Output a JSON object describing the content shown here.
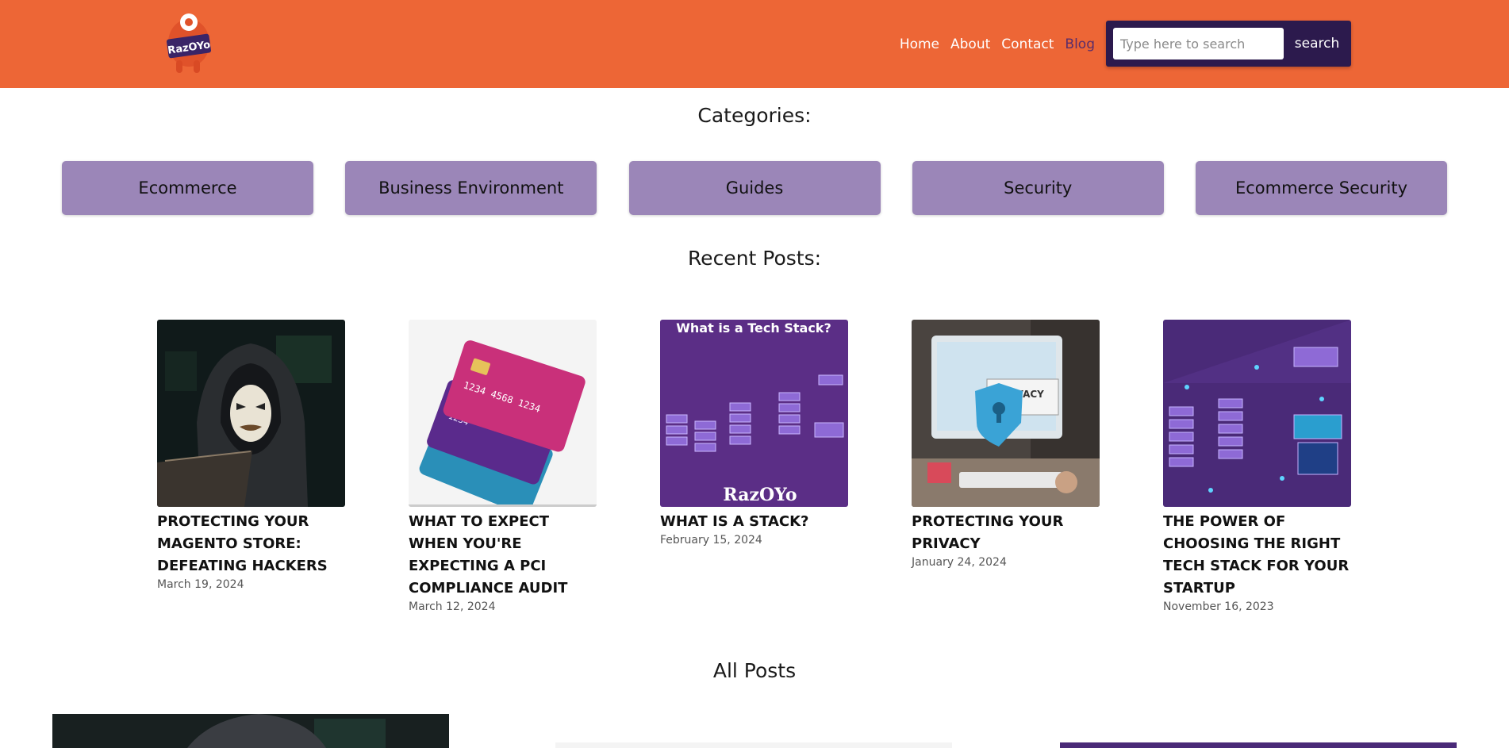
{
  "header": {
    "logo_text": "RazOYo",
    "nav": [
      {
        "label": "Home"
      },
      {
        "label": "About"
      },
      {
        "label": "Contact"
      },
      {
        "label": "Blog"
      }
    ],
    "search": {
      "placeholder": "Type here to search",
      "button_label": "search"
    },
    "colors": {
      "header_bg": "#ed6636",
      "search_bg": "#2c1a4d",
      "active_nav": "#5a2d6a"
    }
  },
  "categories": {
    "title": "Categories:",
    "items": [
      {
        "label": "Ecommerce"
      },
      {
        "label": "Business Environment"
      },
      {
        "label": "Guides"
      },
      {
        "label": "Security"
      },
      {
        "label": "Ecommerce Security"
      }
    ],
    "button_color": "#9b86b8"
  },
  "recent_posts": {
    "title": "Recent Posts:",
    "items": [
      {
        "title": "PROTECTING YOUR MAGENTO STORE: DEFEATING HACKERS",
        "date": "March 19, 2024",
        "image": "hooded-hacker-icon"
      },
      {
        "title": "WHAT TO EXPECT WHEN YOU'RE EXPECTING A PCI COMPLIANCE AUDIT",
        "date": "March 12, 2024",
        "image": "credit-cards-icon"
      },
      {
        "title": "WHAT IS A STACK?",
        "date": "February 15, 2024",
        "image": "tech-stack-icon",
        "image_caption": "What is a Tech Stack?",
        "image_logo": "RazOYo"
      },
      {
        "title": "PROTECTING YOUR PRIVACY",
        "date": "January 24, 2024",
        "image": "privacy-shield-icon",
        "image_caption": "PRIVACY"
      },
      {
        "title": "THE POWER OF CHOOSING THE RIGHT TECH STACK FOR YOUR STARTUP",
        "date": "November 16, 2023",
        "image": "server-stack-icon"
      }
    ]
  },
  "all_posts": {
    "title": "All Posts"
  }
}
